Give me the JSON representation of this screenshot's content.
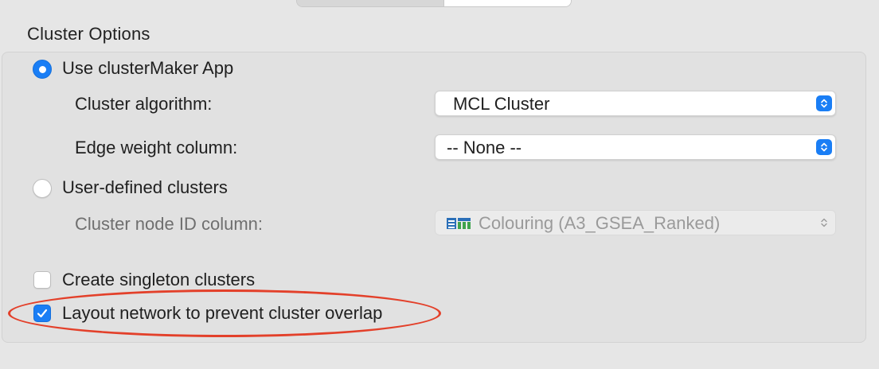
{
  "section": {
    "title": "Cluster Options"
  },
  "options": {
    "use_clustermaker": {
      "label": "Use clusterMaker App",
      "selected": true
    },
    "cluster_algorithm": {
      "label": "Cluster algorithm:",
      "value": "MCL Cluster"
    },
    "edge_weight_column": {
      "label": "Edge weight column:",
      "value": "-- None --"
    },
    "user_defined": {
      "label": "User-defined clusters",
      "selected": false
    },
    "cluster_node_id": {
      "label": "Cluster node ID column:",
      "value": "Colouring (A3_GSEA_Ranked)",
      "disabled": true
    },
    "create_singleton": {
      "label": "Create singleton clusters",
      "checked": false
    },
    "layout_network": {
      "label": "Layout network to prevent cluster overlap",
      "checked": true
    }
  },
  "colors": {
    "accent": "#1a7ef5",
    "annotation": "#e3402a",
    "background": "#e6e6e6",
    "group_box": "#e1e1e1"
  },
  "icons": {
    "radio_selected": "radio-selected-icon",
    "stepper": "chevron-updown-icon",
    "checkmark": "checkmark-icon",
    "table": "table-column-icon"
  }
}
